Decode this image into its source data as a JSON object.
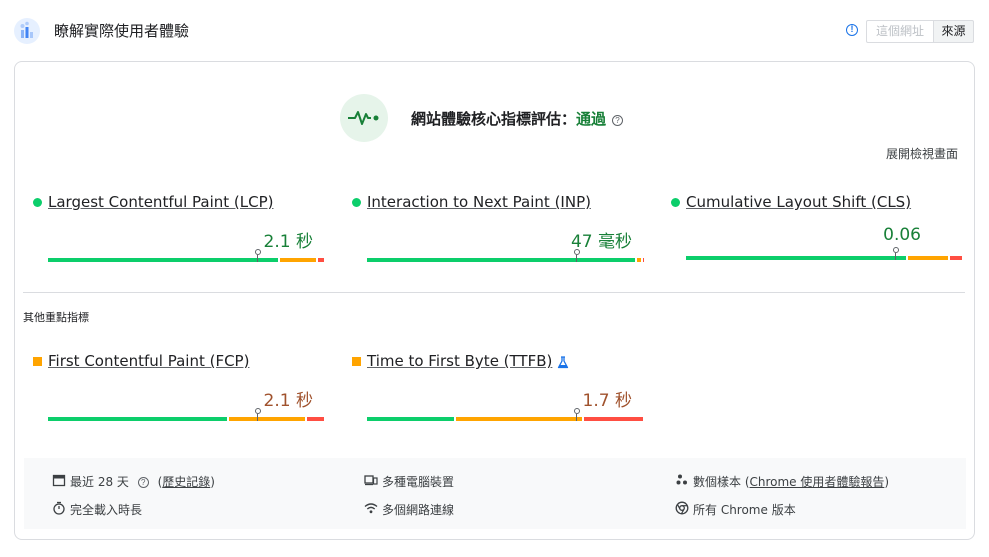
{
  "header": {
    "title": "瞭解實際使用者體驗",
    "logo_icon": "crux-chart-icon",
    "info_icon": "info-icon",
    "toggle": {
      "url_label": "這個網址",
      "origin_label": "來源",
      "selected": "origin"
    }
  },
  "assessment": {
    "icon": "pulse-icon",
    "label": "網站體驗核心指標評估：",
    "result": "通過",
    "help_icon": "help-icon",
    "expand_label": "展開檢視畫面"
  },
  "core_metrics": [
    {
      "name": "Largest Contentful Paint (LCP)",
      "value": "2.1 秒",
      "status": "good",
      "distribution": {
        "good": 0.8,
        "needs_improvement": 0.13,
        "poor": 0.03
      },
      "p75_position": 0.75
    },
    {
      "name": "Interaction to Next Paint (INP)",
      "value": "47 毫秒",
      "status": "good",
      "distribution": {
        "good": 0.97,
        "needs_improvement": 0.02,
        "poor": 0.01
      },
      "p75_position": 0.75
    },
    {
      "name": "Cumulative Layout Shift (CLS)",
      "value": "0.06",
      "status": "good",
      "distribution": {
        "good": 0.8,
        "needs_improvement": 0.15,
        "poor": 0.05
      },
      "p75_position": 0.75
    }
  ],
  "other_metrics_label": "其他重點指標",
  "other_metrics": [
    {
      "name": "First Contentful Paint (FCP)",
      "value": "2.1 秒",
      "status": "needs-improvement",
      "distribution": {
        "good": 0.65,
        "needs_improvement": 0.28,
        "poor": 0.07
      },
      "p75_position": 0.75
    },
    {
      "name": "Time to First Byte (TTFB)",
      "value": "1.7 秒",
      "status": "needs-improvement",
      "experimental_icon": "flask-icon",
      "distribution": {
        "good": 0.32,
        "needs_improvement": 0.46,
        "poor": 0.22
      },
      "p75_position": 0.75
    }
  ],
  "footer": {
    "period": {
      "icon": "calendar-icon",
      "text": "最近 28 天",
      "help_icon": "help-icon",
      "link_open": "(",
      "link": "歷史記錄",
      "link_close": ")"
    },
    "devices": {
      "icon": "devices-icon",
      "text": "多種電腦裝置"
    },
    "samples": {
      "icon": "samples-icon",
      "text": "數個樣本 (",
      "link": "Chrome 使用者體驗報告",
      "suffix": ")"
    },
    "duration": {
      "icon": "timer-icon",
      "text": "完全載入時長"
    },
    "network": {
      "icon": "wifi-icon",
      "text": "多個網路連線"
    },
    "versions": {
      "icon": "chrome-icon",
      "text": "所有 Chrome 版本"
    }
  },
  "colors": {
    "good": "#0cce6b",
    "needs_improvement": "#ffa400",
    "poor": "#ff4e42",
    "good_text": "#188038",
    "ni_text": "#a0522d"
  }
}
